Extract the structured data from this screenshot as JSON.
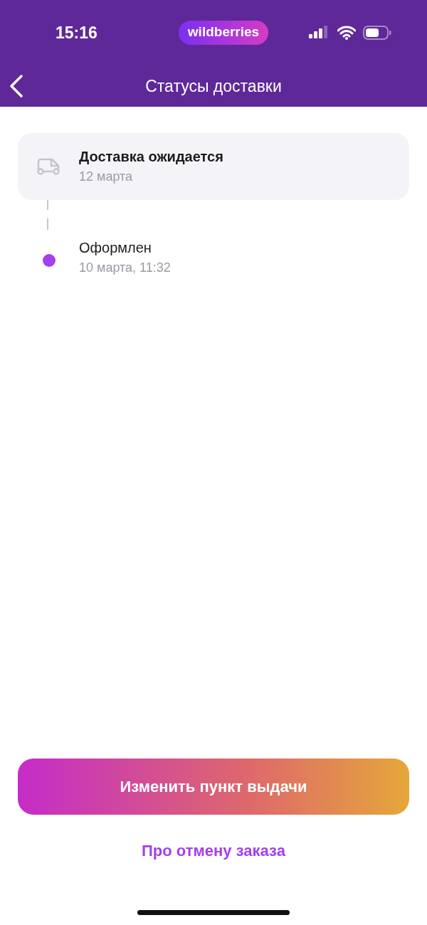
{
  "status_bar": {
    "time": "15:16",
    "logo": "wildberries"
  },
  "nav": {
    "title": "Статусы доставки"
  },
  "statuses": [
    {
      "kind": "upcoming",
      "title": "Доставка ожидается",
      "date": "12 марта"
    },
    {
      "kind": "done",
      "title": "Оформлен",
      "date": "10 марта, 11:32"
    }
  ],
  "primary_button": "Изменить пункт выдачи",
  "link": "Про отмену заказа"
}
